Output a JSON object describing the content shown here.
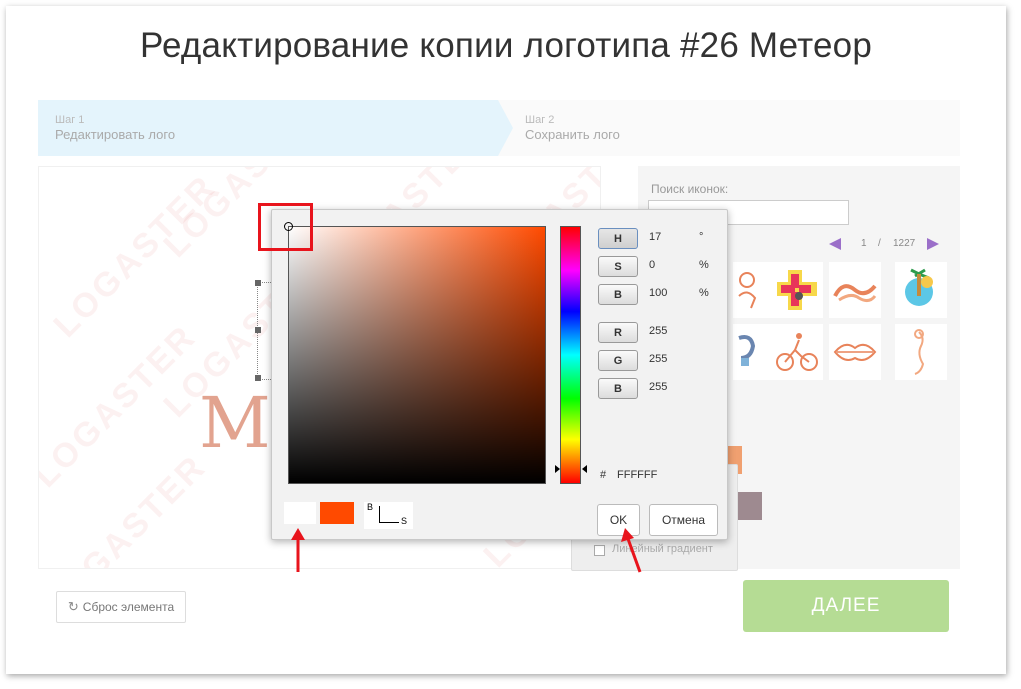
{
  "page": {
    "title": "Редактирование копии логотипа #26 Метеор"
  },
  "steps": [
    {
      "num": "Шаг 1",
      "label": "Редактировать лого"
    },
    {
      "num": "Шаг 2",
      "label": "Сохранить лого"
    }
  ],
  "canvas": {
    "watermark": "LOGASTER",
    "logo_text": "Me"
  },
  "panel": {
    "search_label": "Поиск иконок:",
    "search_value": "",
    "pager_current": "1",
    "pager_sep": "/",
    "pager_total": "1227",
    "gradient_label": "Линейный градиент"
  },
  "picker": {
    "channels": [
      {
        "key": "H",
        "value": "17",
        "unit": "°"
      },
      {
        "key": "S",
        "value": "0",
        "unit": "%"
      },
      {
        "key": "B",
        "value": "100",
        "unit": "%"
      },
      {
        "key": "R",
        "value": "255",
        "unit": ""
      },
      {
        "key": "G",
        "value": "255",
        "unit": ""
      },
      {
        "key": "B",
        "value": "255",
        "unit": ""
      }
    ],
    "hex_prefix": "#",
    "hex": "FFFFFF",
    "axis_b": "B",
    "axis_s": "S",
    "ok_label": "OK",
    "cancel_label": "Отмена",
    "current_color": "#ffffff",
    "new_color": "#ff4a00"
  },
  "buttons": {
    "reset_label": "Сброс элемента",
    "next_label": "ДАЛЕЕ"
  },
  "colors": {
    "accent_green": "#b5dc94",
    "step_active_bg": "#e4f4fc",
    "highlight_red": "#e8141c"
  }
}
